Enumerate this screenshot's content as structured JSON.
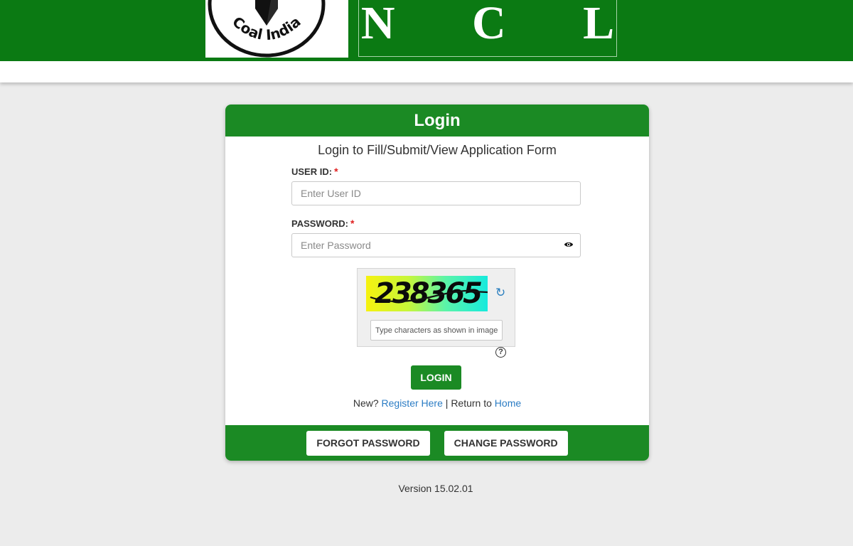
{
  "header": {
    "logo_text": "Coal India",
    "brand": "N C L",
    "brand_color": "#0b7a13"
  },
  "login_card": {
    "title": "Login",
    "subtitle": "Login to Fill/Submit/View Application Form",
    "user_id": {
      "label": "USER ID:",
      "required_mark": "*",
      "placeholder": "Enter User ID",
      "value": ""
    },
    "password": {
      "label": "PASSWORD:",
      "required_mark": "*",
      "placeholder": "Enter Password",
      "value": "",
      "toggle_icon": "eye-icon"
    },
    "captcha": {
      "text": "238365",
      "refresh_icon": "refresh-icon",
      "input_placeholder": "Type characters as shown in image",
      "help_icon": "help-icon",
      "help_symbol": "?"
    },
    "login_button": "LOGIN",
    "register": {
      "prefix": "New?",
      "register_link": "Register Here",
      "separator": "|",
      "return_text": "Return to",
      "home_link": "Home"
    },
    "footer": {
      "forgot_password": "FORGOT PASSWORD",
      "change_password": "CHANGE PASSWORD"
    },
    "accent_color": "#1b8a24",
    "link_color": "#2b7cc4"
  },
  "version": "Version 15.02.01"
}
